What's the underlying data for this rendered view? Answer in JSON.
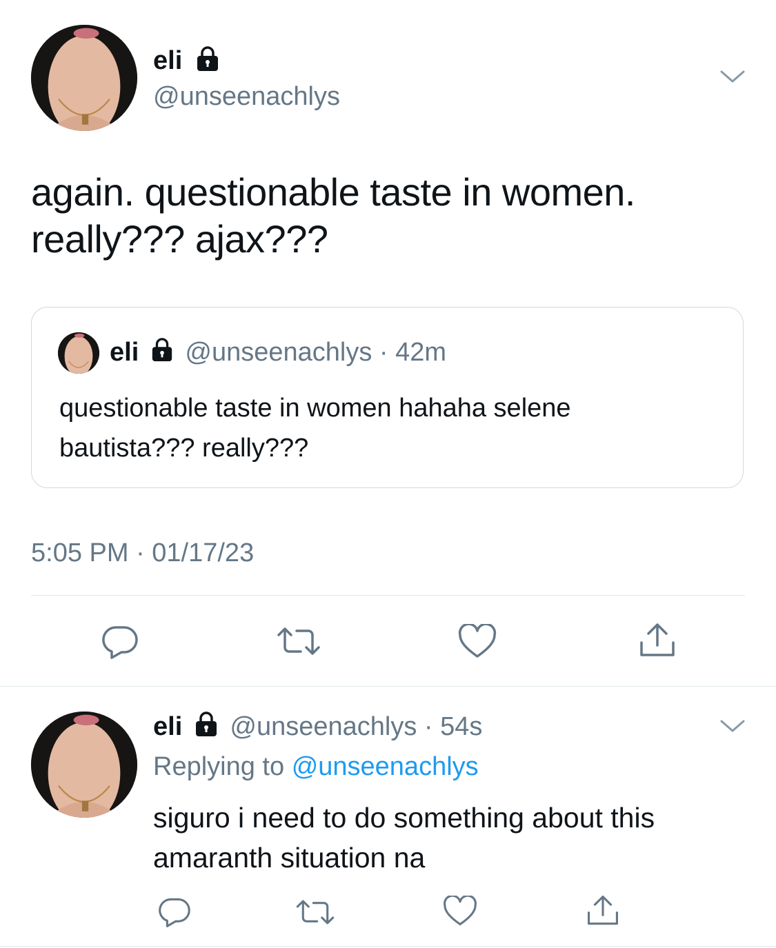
{
  "main_tweet": {
    "display_name": "eli",
    "handle": "@unseenachlys",
    "text_line1": "again. questionable taste in women.",
    "text_line2": "really??? ajax???",
    "timestamp": "5:05 PM · 01/17/23"
  },
  "quoted_tweet": {
    "display_name": "eli",
    "handle": "@unseenachlys",
    "separator": "·",
    "time": "42m",
    "text_line1": "questionable taste in women hahaha selene",
    "text_line2": "bautista??? really???"
  },
  "reply_tweet": {
    "display_name": "eli",
    "handle": "@unseenachlys",
    "separator": "·",
    "time": "54s",
    "replying_prefix": "Replying to",
    "replying_handle": "@unseenachlys",
    "text_line1": "siguro i need to do something about this",
    "text_line2": "amaranth situation na"
  },
  "icons": {
    "lock": "lock-icon",
    "chevron": "chevron-down-icon",
    "reply": "reply-icon",
    "retweet": "retweet-icon",
    "like": "heart-icon",
    "share": "share-icon"
  },
  "colors": {
    "text": "#0f1419",
    "muted": "#657786",
    "link": "#1d9bf0",
    "divider": "#e1e8ed"
  }
}
